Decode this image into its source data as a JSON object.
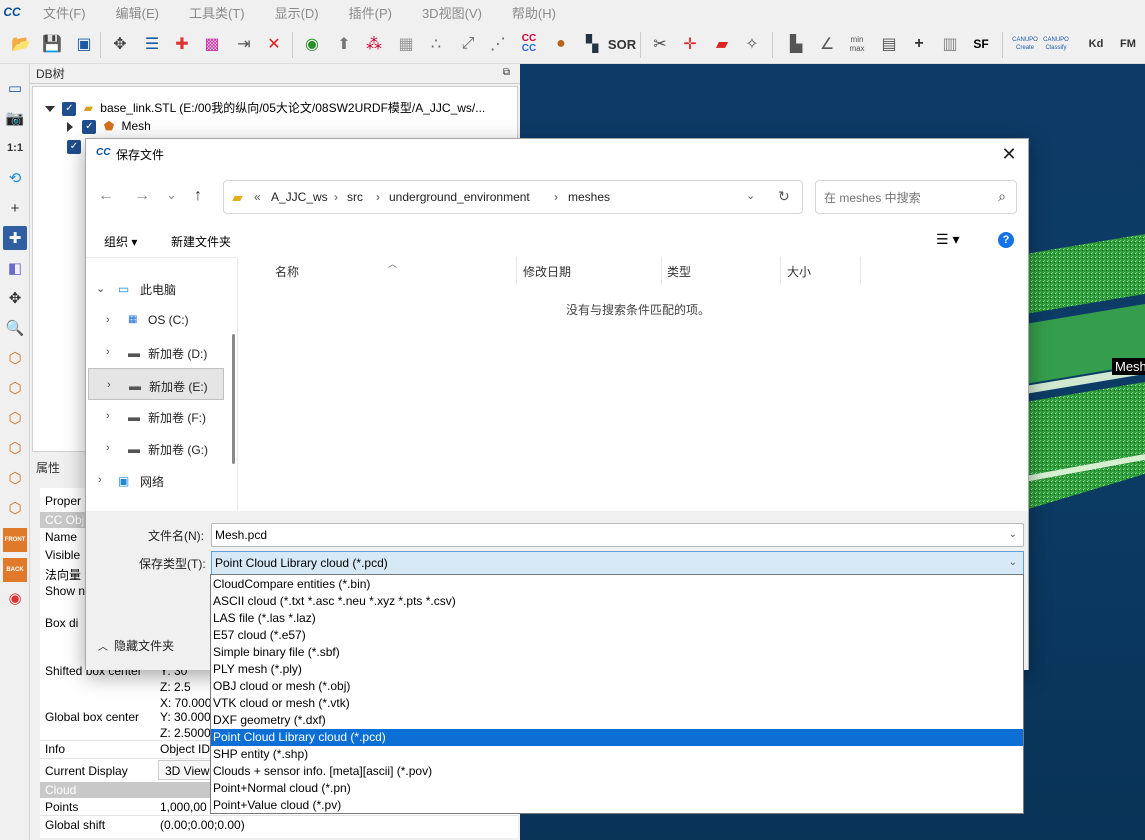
{
  "menubar": {
    "logo": "CC",
    "items": [
      "文件(F)",
      "编辑(E)",
      "工具类(T)",
      "显示(D)",
      "插件(P)",
      "3D视图(V)",
      "帮助(H)"
    ]
  },
  "toolbar": {
    "labels": {
      "sor": "SOR",
      "sf": "SF",
      "ccc": "CC",
      "kd": "Kd",
      "fm": "FM",
      "canupo1": "CANUPO",
      "create": "Create",
      "canupo2": "CANUPO",
      "classify": "Classify",
      "min": "min",
      "max": "max"
    }
  },
  "lefttoolbar": {
    "ratio": "1:1",
    "front": "FRONT",
    "back": "BACK"
  },
  "dbtree": {
    "title": "DB树",
    "root_label": "base_link.STL (E:/00我的纵向/05大论文/08SW2URDF模型/A_JJC_ws/...",
    "child_label": "Mesh"
  },
  "properties": {
    "title": "属性",
    "rows": {
      "proper": "Proper",
      "ccobj": "CC Obj",
      "name": "Name",
      "visible": "Visible",
      "normals": "法向量",
      "show": "Show n",
      "boxdim": "Box di",
      "shifted_label": "Shifted box center",
      "shifted_y": "Y: 30",
      "shifted_z": "Z: 2.5",
      "global_label": "Global box center",
      "global_x": "X: 70.000",
      "global_y": "Y: 30.000",
      "global_z": "Z: 2.5000",
      "info_label": "Info",
      "info_value": "Object ID",
      "display_label": "Current Display",
      "display_value": "3D View",
      "cloud": "Cloud",
      "points_label": "Points",
      "points_value": "1,000,00",
      "shift_label": "Global shift",
      "shift_value": "(0.00;0.00;0.00)"
    }
  },
  "view3d": {
    "label": "Mesh"
  },
  "dialog": {
    "title": "保存文件",
    "close": "✕",
    "nav": {
      "back": "←",
      "forward": "→",
      "recent": "⌄",
      "up": "↑",
      "refresh": "↻"
    },
    "breadcrumb": [
      "«",
      "A_JJC_ws",
      "›",
      "src",
      "›",
      "underground_environment",
      "›",
      "meshes"
    ],
    "search_placeholder": "在 meshes 中搜索",
    "commands": {
      "organize": "组织 ▾",
      "new_folder": "新建文件夹"
    },
    "navpane": [
      {
        "label": "此电脑",
        "icon": "pc-icon"
      },
      {
        "label": "OS (C:)",
        "icon": "drive-icon"
      },
      {
        "label": "新加卷 (D:)",
        "icon": "drive-icon"
      },
      {
        "label": "新加卷 (E:)",
        "icon": "drive-icon"
      },
      {
        "label": "新加卷 (F:)",
        "icon": "drive-icon"
      },
      {
        "label": "新加卷 (G:)",
        "icon": "drive-icon"
      },
      {
        "label": "网络",
        "icon": "network-icon"
      }
    ],
    "columns": [
      "名称",
      "修改日期",
      "类型",
      "大小"
    ],
    "empty_text": "没有与搜索条件匹配的项。",
    "filename_label": "文件名(N):",
    "filename_value": "Mesh.pcd",
    "filetype_label": "保存类型(T):",
    "filetype_value": "Point Cloud Library cloud (*.pcd)",
    "hide_folders": "隐藏文件夹"
  },
  "filetypes": {
    "selected_index": 9,
    "options": [
      "CloudCompare entities (*.bin)",
      "ASCII cloud (*.txt *.asc *.neu *.xyz *.pts *.csv)",
      "LAS file (*.las *.laz)",
      "E57 cloud (*.e57)",
      "Simple binary file (*.sbf)",
      "PLY mesh (*.ply)",
      "OBJ cloud or mesh (*.obj)",
      "VTK cloud or mesh (*.vtk)",
      "DXF geometry (*.dxf)",
      "Point Cloud Library cloud (*.pcd)",
      "SHP entity (*.shp)",
      "Clouds + sensor info. [meta][ascii] (*.pov)",
      "Point+Normal cloud (*.pn)",
      "Point+Value cloud (*.pv)"
    ]
  },
  "colors": {
    "accent": "#0b6fd6",
    "view_bg": "#0c3c66",
    "points": "#2e9e3a"
  }
}
